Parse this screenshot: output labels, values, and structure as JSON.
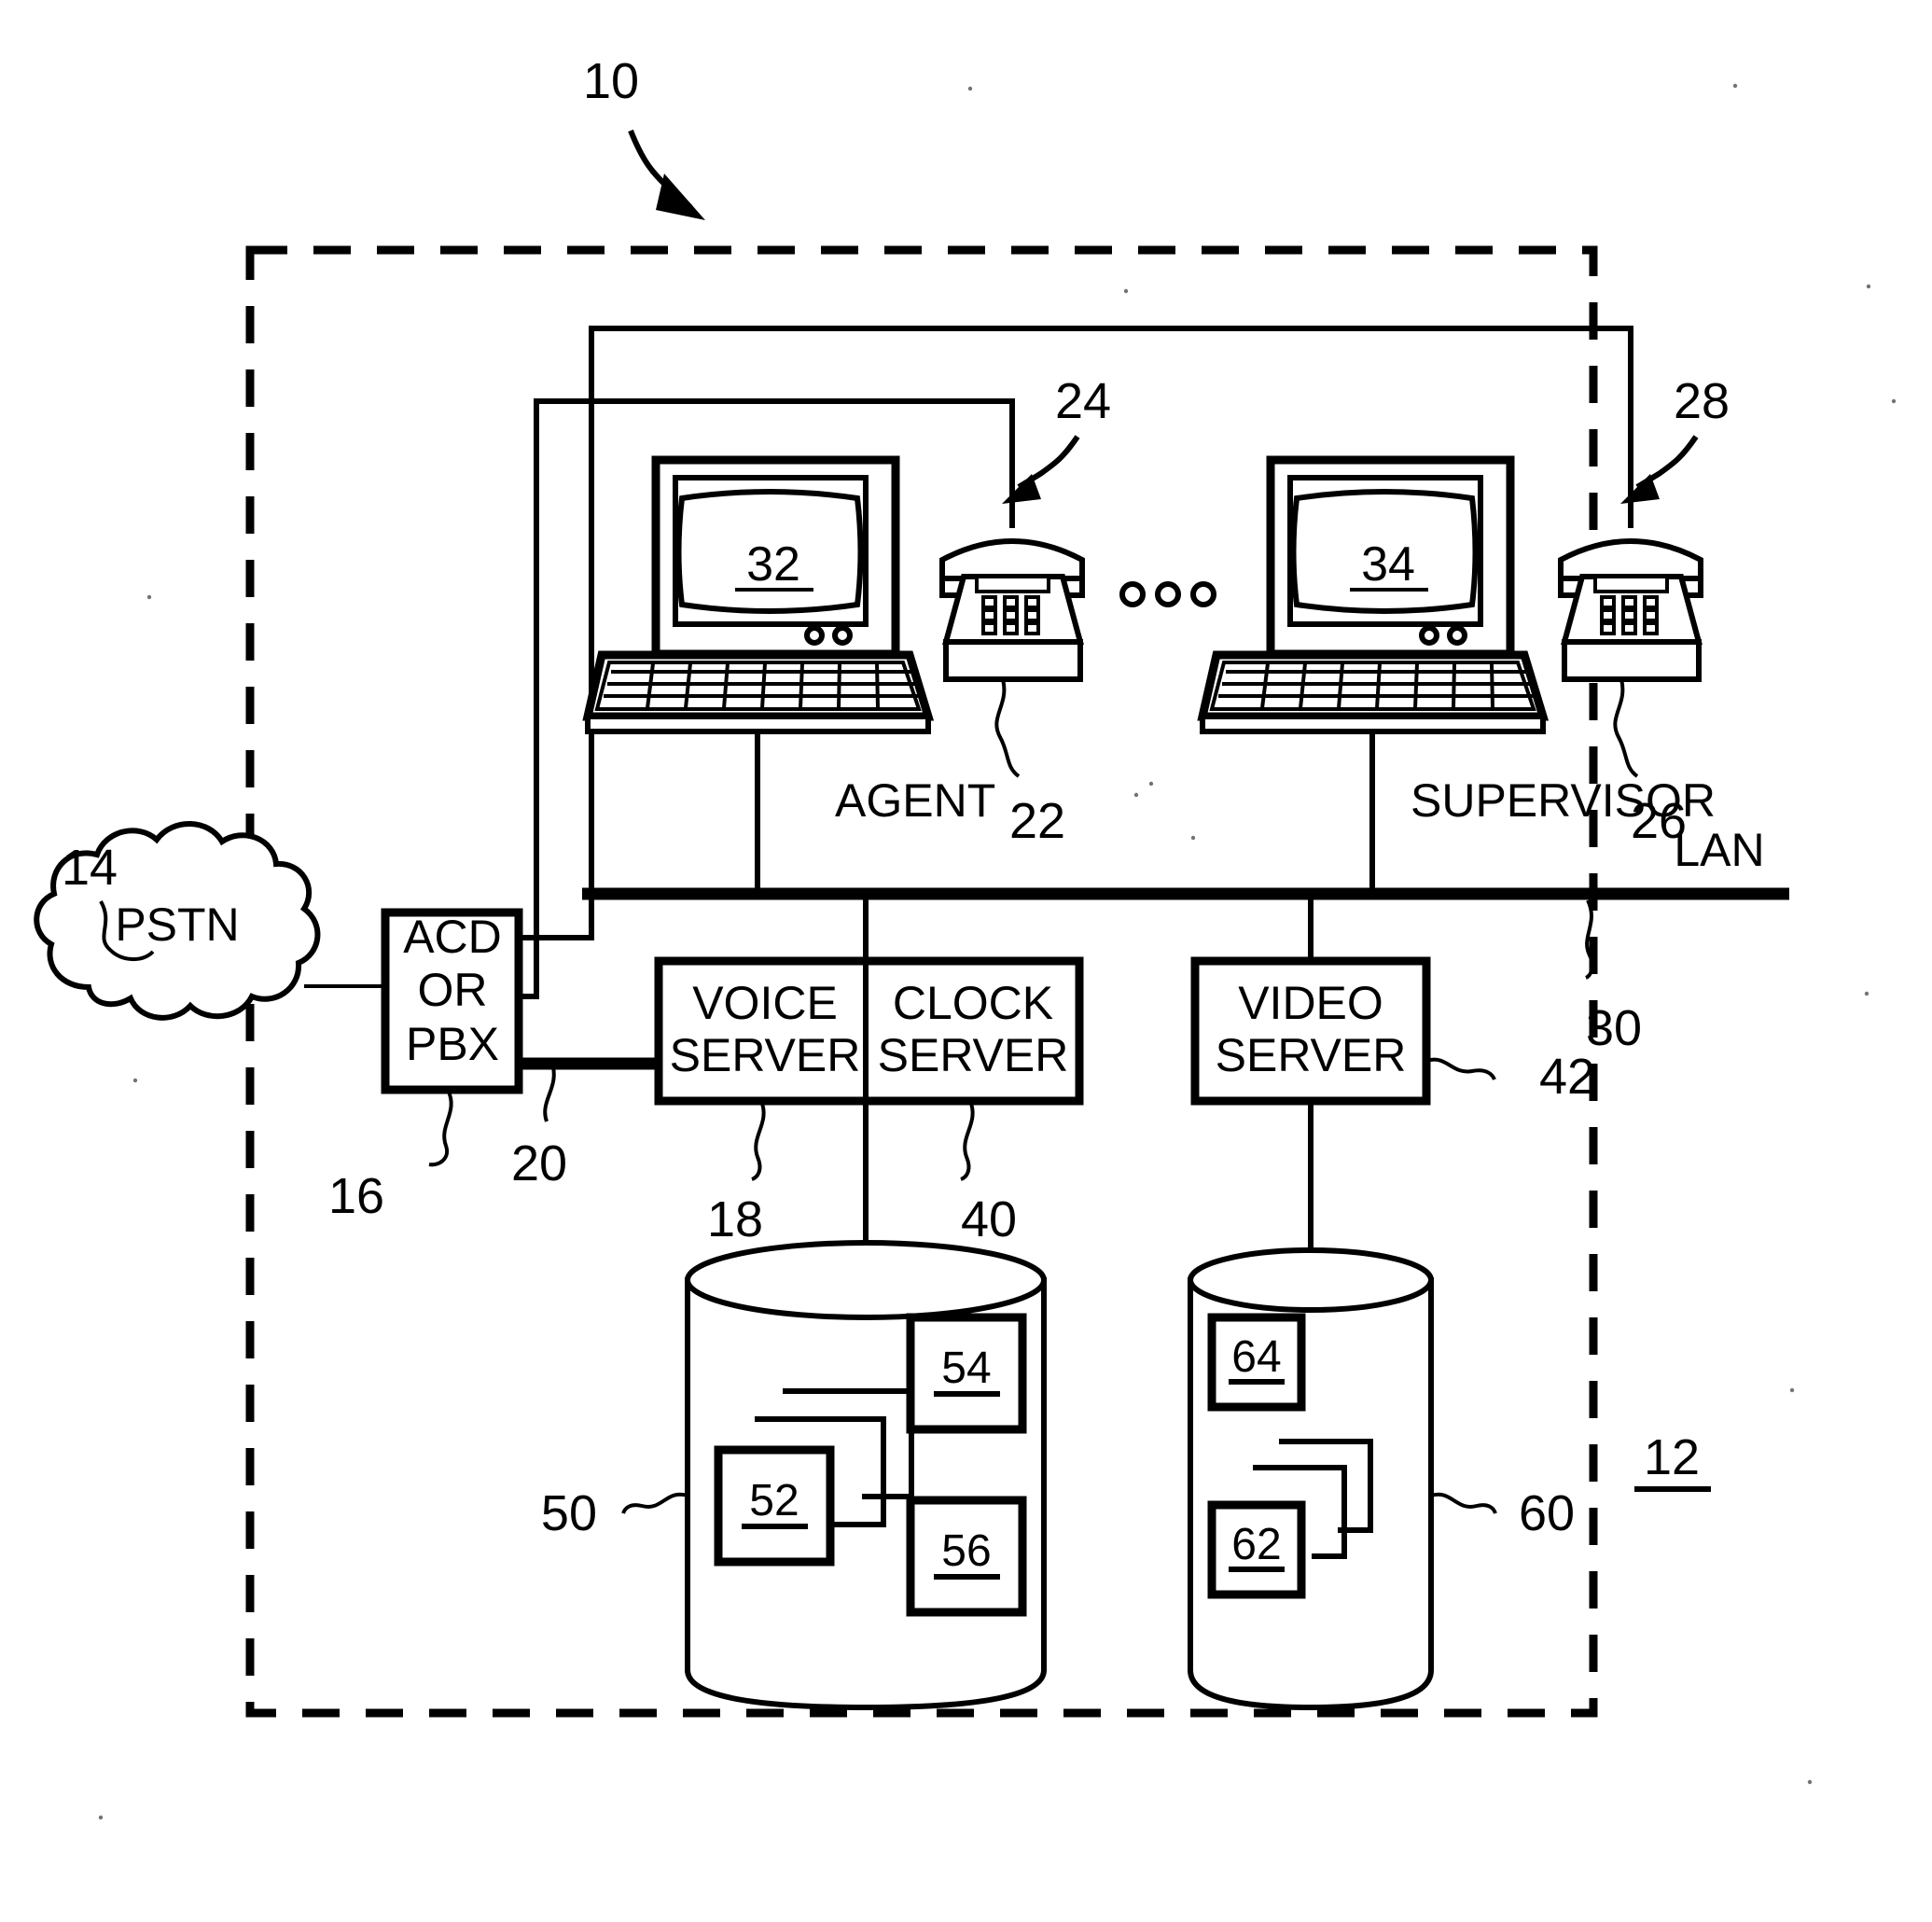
{
  "figure": {
    "type": "patent-diagram",
    "title_ref": "10",
    "system_boundary_ref": "12"
  },
  "refs": {
    "system": "10",
    "enterprise": "12",
    "pstn": "14",
    "acd_pbx": "16",
    "voice_server": "18",
    "trunk": "20",
    "agent_phone": "22",
    "agent_phone_link": "24",
    "supervisor_phone": "26",
    "supervisor_phone_link": "28",
    "lan": "30",
    "agent_workstation": "32",
    "supervisor_workstation": "34",
    "clock_server": "40",
    "video_server": "42",
    "voice_database": "50",
    "voice_record_a": "52",
    "voice_record_b": "54",
    "voice_record_c": "56",
    "video_database": "60",
    "video_record_a": "62",
    "video_record_b": "64"
  },
  "nodes": {
    "pstn": {
      "label": "PSTN",
      "ref": "14"
    },
    "acd_pbx": {
      "line1": "ACD",
      "line2": "OR",
      "line3": "PBX",
      "ref": "16"
    },
    "voice_server": {
      "line1": "VOICE",
      "line2": "SERVER",
      "ref": "18"
    },
    "clock_server": {
      "line1": "CLOCK",
      "line2": "SERVER",
      "ref": "40"
    },
    "video_server": {
      "line1": "VIDEO",
      "line2": "SERVER",
      "ref": "42"
    },
    "agent": {
      "label": "AGENT",
      "screen_ref": "32",
      "phone_ref": "22",
      "phone_link_ref": "24"
    },
    "supervisor": {
      "label": "SUPERVISOR",
      "screen_ref": "34",
      "phone_ref": "26",
      "phone_link_ref": "28"
    },
    "lan": {
      "label": "LAN",
      "ref": "30"
    },
    "voice_db": {
      "ref": "50",
      "records": [
        "52",
        "54",
        "56"
      ]
    },
    "video_db": {
      "ref": "60",
      "records": [
        "62",
        "64"
      ]
    }
  },
  "ellipsis": "• • •",
  "colors": {
    "ink": "#000000",
    "paper": "#ffffff"
  }
}
